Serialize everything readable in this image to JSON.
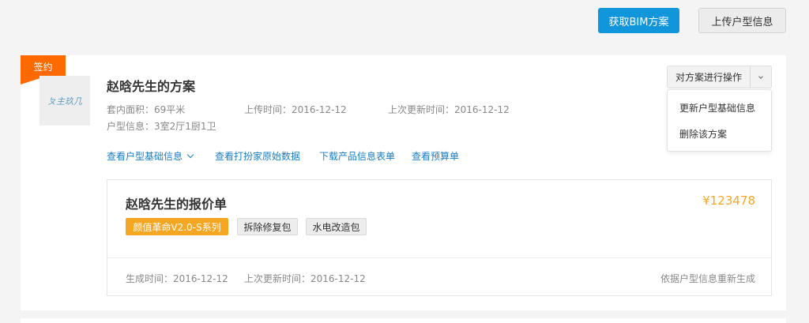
{
  "header": {
    "get_bim_label": "获取BIM方案",
    "upload_label": "上传户型信息"
  },
  "plan": {
    "badge": "签约",
    "thumb_logo": "ㄆ主玖几",
    "title": "赵晗先生的方案",
    "area_label": "套内面积：",
    "area_value": "69平米",
    "upload_time_label": "上传时间：",
    "upload_time_value": "2016-12-12",
    "update_time_label": "上次更新时间：",
    "update_time_value": "2016-12-12",
    "layout_label": "户型信息：",
    "layout_value": "3室2厅1厨1卫",
    "links": {
      "basic_info": "查看户型基础信息",
      "raw_data": "查看打扮家原始数据",
      "download": "下载产品信息表单",
      "budget": "查看预算单"
    },
    "operations": {
      "label": "对方案进行操作",
      "menu": [
        "更新户型基础信息",
        "删除该方案"
      ]
    }
  },
  "quote": {
    "title": "赵晗先生的报价单",
    "price": "¥123478",
    "tags": [
      "颜值革命V2.0-S系列",
      "拆除修复包",
      "水电改造包"
    ],
    "created_label": "生成时间：",
    "created_value": "2016-12-12",
    "updated_label": "上次更新时间：",
    "updated_value": "2016-12-12",
    "regenerate": "依据户型信息重新生成"
  },
  "colors": {
    "primary": "#1296db",
    "badge": "#ff6a00",
    "price": "#f5a623",
    "link": "#1a7dc4"
  }
}
